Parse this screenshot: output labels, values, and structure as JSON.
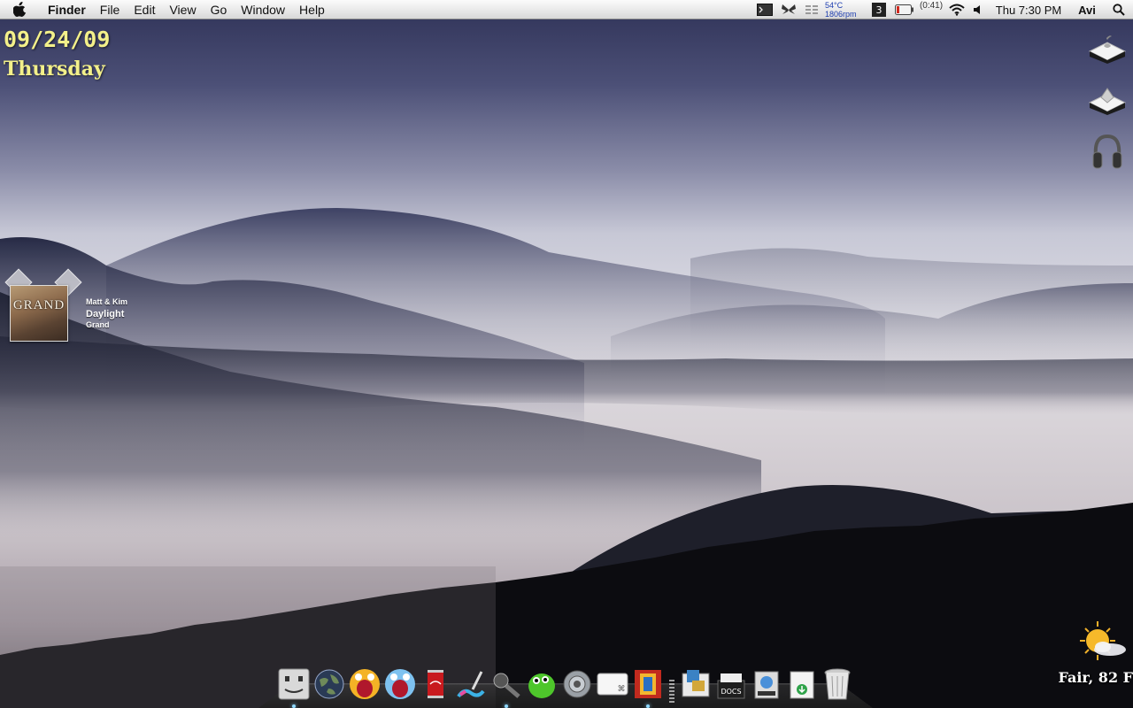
{
  "menubar": {
    "apple_icon": "apple-icon",
    "app_name": "Finder",
    "menus": [
      "File",
      "Edit",
      "View",
      "Go",
      "Window",
      "Help"
    ],
    "status": {
      "temperature": "54°C",
      "fan_speed": "1806rpm",
      "battery_time": "(0:41)",
      "clock": "Thu 7:30 PM",
      "user": "Avi"
    }
  },
  "date_widget": {
    "date": "09/24/09",
    "day": "Thursday"
  },
  "now_playing": {
    "album_art_title": "GRAND",
    "artist": "Matt & Kim",
    "track": "Daylight",
    "album": "Grand"
  },
  "weather": {
    "condition_text": "Fair, 82 F"
  },
  "desktop_icons": [
    "drive-icon",
    "drive-icon",
    "headphones-icon"
  ],
  "dock": {
    "apps": [
      "finder-icon",
      "globe-icon",
      "screaming-face-icon",
      "screaming-face-blue-icon",
      "coca-cola-can-icon",
      "paint-icon",
      "microphone-icon",
      "green-creature-icon",
      "gear-icon",
      "keyboard-key-icon",
      "photo-booth-icon"
    ],
    "stacks": [
      "applications-stack-icon",
      "docs-stack-icon",
      "media-stack-icon",
      "downloads-stack-icon",
      "trash-icon"
    ],
    "docs_label": "DOCS"
  },
  "colors": {
    "date_text": "#f3f08a",
    "menubar": "#e9e9e9",
    "temperature_text": "#1f3fb0"
  }
}
